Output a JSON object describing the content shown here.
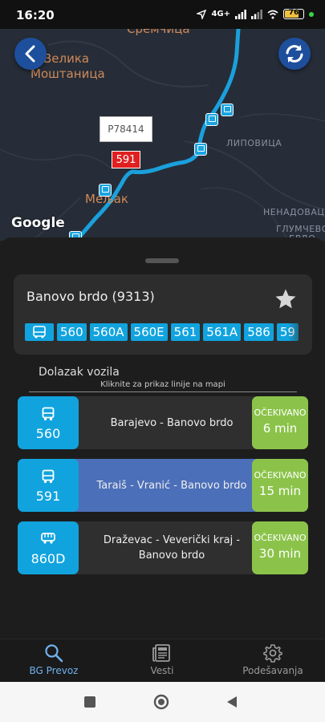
{
  "status_bar": {
    "time": "16:20",
    "network": "4G+",
    "battery": "76",
    "indicator_color": "#37d34b"
  },
  "map": {
    "labels": {
      "village_1_line1": "Велика",
      "village_1_line2": "Моштаница",
      "town_melak": "Мељак",
      "lipovica": "ЛИПОВИЦА",
      "nenadovac": "НЕНАДОВАЦ",
      "glumcevo": "ГЛУМЧЕВО",
      "top_partial": "Сремчица",
      "bottom_partial": "БРДО"
    },
    "vehicle_callout": "P78414",
    "vehicle_line": "591",
    "attribution": "Google",
    "route_color": "#1aa0dc",
    "back_icon": "chevron-left-icon",
    "refresh_icon": "refresh-icon"
  },
  "stop": {
    "name": "Banovo brdo (9313)",
    "favorite_icon": "star-icon",
    "lines": [
      "560",
      "560A",
      "560E",
      "561",
      "561A",
      "586",
      "59"
    ]
  },
  "arrivals_section": {
    "title": "Dolazak vozila",
    "hint": "Kliknite za prikaz linije na mapi"
  },
  "arrivals": [
    {
      "line": "560",
      "icon": "bus-icon",
      "destination": "Barajevo - Banovo brdo",
      "eta_label": "OČEKIVANO",
      "eta": "6 min",
      "highlighted": false
    },
    {
      "line": "591",
      "icon": "bus-icon",
      "destination": "Taraiš - Vranić - Banovo brdo",
      "eta_label": "OČEKIVANO",
      "eta": "15 min",
      "highlighted": true
    },
    {
      "line": "860D",
      "icon": "minibus-icon",
      "destination": "Draževac - Veverički kraj - Banovo brdo",
      "eta_label": "OČEKIVANO",
      "eta": "30 min",
      "highlighted": false
    }
  ],
  "bottom_nav": {
    "items": [
      {
        "label": "BG Prevoz",
        "icon": "search-icon",
        "active": true
      },
      {
        "label": "Vesti",
        "icon": "newspaper-icon",
        "active": false
      },
      {
        "label": "Podešavanja",
        "icon": "gear-icon",
        "active": false
      }
    ]
  },
  "colors": {
    "accent_blue": "#11a3de",
    "eta_green": "#8bc34a",
    "highlight_row": "#4c6fb9",
    "vehicle_red": "#e02020"
  }
}
